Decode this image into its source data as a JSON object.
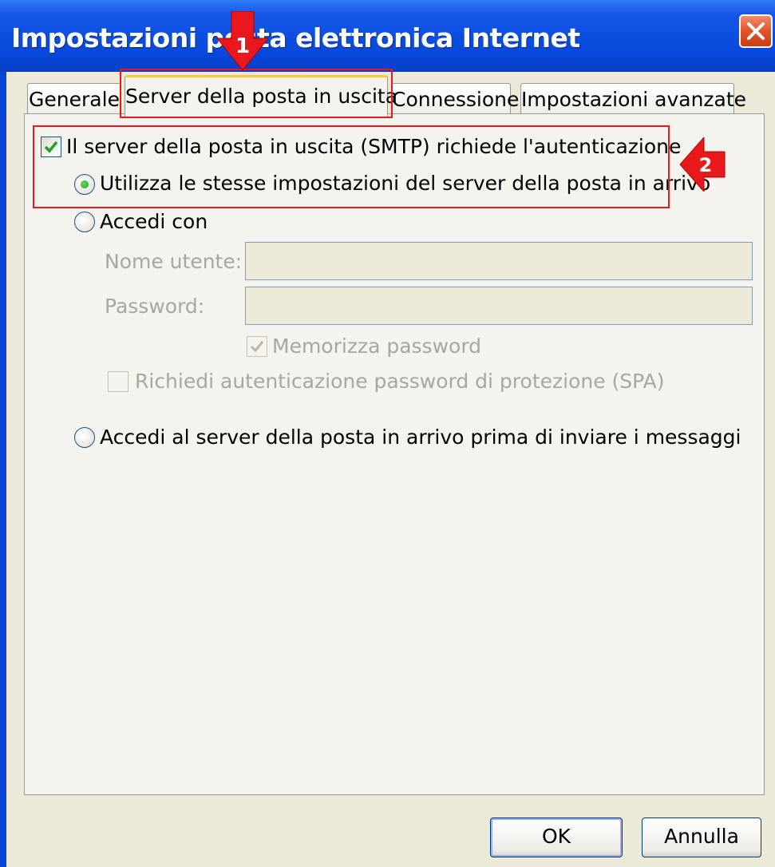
{
  "window": {
    "title": "Impostazioni posta elettronica Internet"
  },
  "tabs": [
    {
      "label": "Generale"
    },
    {
      "label": "Server della posta in uscita"
    },
    {
      "label": "Connessione"
    },
    {
      "label": "Impostazioni avanzate"
    }
  ],
  "smtp_auth": {
    "checkbox_label": "Il server della posta in uscita (SMTP) richiede l'autenticazione",
    "checked": true,
    "options": {
      "same_settings": "Utilizza le stesse impostazioni del server della posta in arrivo",
      "login_with": "Accedi con",
      "login_before": "Accedi al server della posta in arrivo prima di inviare i messaggi"
    },
    "selected_option": "same_settings",
    "username_label": "Nome utente:",
    "username_value": "",
    "password_label": "Password:",
    "password_value": "",
    "remember_password_label": "Memorizza password",
    "remember_password_checked": true,
    "spa_label": "Richiedi autenticazione password di protezione (SPA)",
    "spa_checked": false
  },
  "buttons": {
    "ok": "OK",
    "cancel": "Annulla"
  },
  "annotations": {
    "step1": "1",
    "step2": "2"
  },
  "colors": {
    "titlebar": "#0846d8",
    "highlight": "#e8181c",
    "dialog_bg": "#ece9d8",
    "tab_accent": "#ffc83c"
  }
}
